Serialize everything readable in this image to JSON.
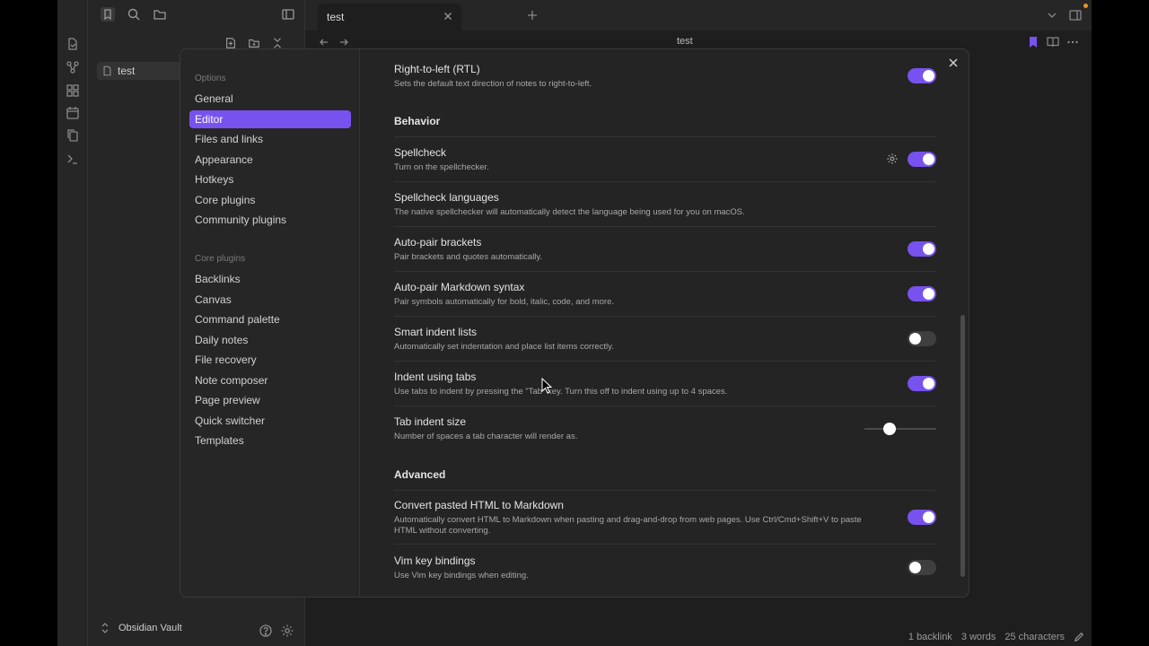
{
  "tab": {
    "title": "test"
  },
  "view": {
    "title": "test"
  },
  "sidebar": {
    "file": "test",
    "vault_name": "Obsidian Vault"
  },
  "status": {
    "backlinks": "1 backlink",
    "words": "3 words",
    "characters": "25 characters"
  },
  "settings": {
    "nav": {
      "options_heading": "Options",
      "options": [
        "General",
        "Editor",
        "Files and links",
        "Appearance",
        "Hotkeys",
        "Core plugins",
        "Community plugins"
      ],
      "active": "Editor",
      "core_heading": "Core plugins",
      "core": [
        "Backlinks",
        "Canvas",
        "Command palette",
        "Daily notes",
        "File recovery",
        "Note composer",
        "Page preview",
        "Quick switcher",
        "Templates"
      ]
    },
    "rtl": {
      "name": "Right-to-left (RTL)",
      "desc": "Sets the default text direction of notes to right-to-left.",
      "enabled": true
    },
    "behavior_heading": "Behavior",
    "spellcheck": {
      "name": "Spellcheck",
      "desc": "Turn on the spellchecker.",
      "enabled": true
    },
    "spellcheck_languages": {
      "name": "Spellcheck languages",
      "desc": "The native spellchecker will automatically detect the language being used for you on macOS."
    },
    "auto_pair_brackets": {
      "name": "Auto-pair brackets",
      "desc": "Pair brackets and quotes automatically.",
      "enabled": true
    },
    "auto_pair_markdown": {
      "name": "Auto-pair Markdown syntax",
      "desc": "Pair symbols automatically for bold, italic, code, and more.",
      "enabled": true
    },
    "smart_indent": {
      "name": "Smart indent lists",
      "desc": "Automatically set indentation and place list items correctly.",
      "enabled": false
    },
    "indent_tabs": {
      "name": "Indent using tabs",
      "desc": "Use tabs to indent by pressing the \"Tab\" key. Turn this off to indent using up to 4 spaces.",
      "enabled": true
    },
    "tab_indent_size": {
      "name": "Tab indent size",
      "desc": "Number of spaces a tab character will render as.",
      "value_fraction": 0.35
    },
    "advanced_heading": "Advanced",
    "convert_html": {
      "name": "Convert pasted HTML to Markdown",
      "desc": "Automatically convert HTML to Markdown when pasting and drag-and-drop from web pages. Use Ctrl/Cmd+Shift+V to paste HTML without converting.",
      "enabled": true
    },
    "vim": {
      "name": "Vim key bindings",
      "desc": "Use Vim key bindings when editing.",
      "enabled": false
    }
  },
  "colors": {
    "accent": "#7852ee",
    "background": "#1e1e1e",
    "panel": "#262626"
  }
}
